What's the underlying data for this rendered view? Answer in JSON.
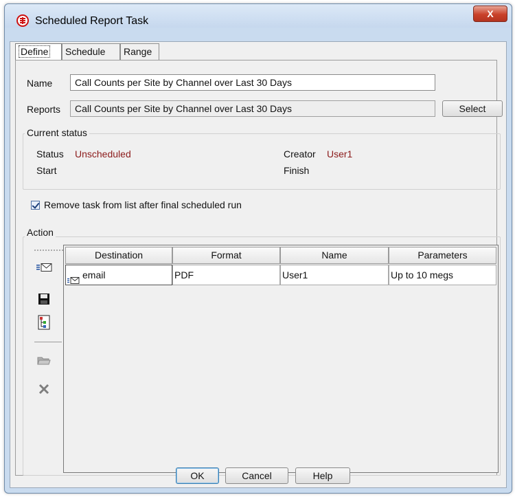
{
  "window": {
    "title": "Scheduled Report Task",
    "close_label": "X"
  },
  "tabs": [
    {
      "label": "Define",
      "active": true
    },
    {
      "label": "Schedule",
      "active": false
    },
    {
      "label": "Range",
      "active": false
    }
  ],
  "define": {
    "name_label": "Name",
    "name_value": "Call Counts per Site by Channel over Last 30 Days",
    "reports_label": "Reports",
    "reports_value": "Call Counts per Site by Channel over Last 30 Days",
    "select_label": "Select"
  },
  "current_status": {
    "legend": "Current status",
    "status_label": "Status",
    "status_value": "Unscheduled",
    "creator_label": "Creator",
    "creator_value": "User1",
    "start_label": "Start",
    "finish_label": "Finish"
  },
  "remove_task": {
    "label": "Remove task from list after final scheduled run",
    "checked": true
  },
  "action": {
    "legend": "Action",
    "toolbar": [
      "add-email-icon",
      "save-icon",
      "report-tree-icon",
      "open-folder-icon",
      "delete-icon"
    ],
    "columns": [
      "Destination",
      "Format",
      "Name",
      "Parameters"
    ],
    "rows": [
      {
        "destination": "email",
        "format": "PDF",
        "name": "User1",
        "parameters": "Up to 10 megs"
      }
    ]
  },
  "footer": {
    "ok_label": "OK",
    "cancel_label": "Cancel",
    "help_label": "Help"
  },
  "colors": {
    "status_value": "#8b1a1a",
    "title_bar": "#c6d8ee",
    "close_button": "#c9412a"
  }
}
